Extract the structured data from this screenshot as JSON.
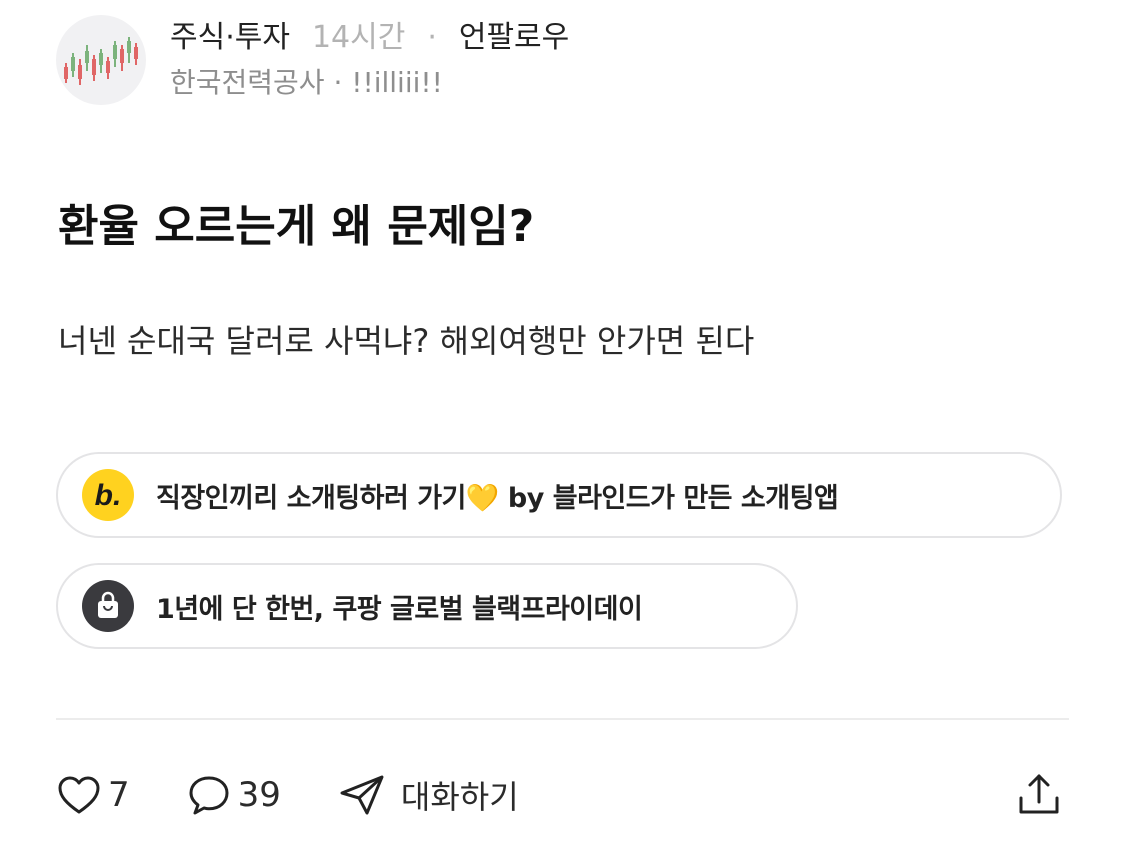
{
  "post": {
    "category": "주식·투자",
    "time": "14시간",
    "separator": "·",
    "follow_label": "언팔로우",
    "author": "한국전력공사 · !!illiii!!",
    "title": "환율 오르는게 왜 문제임?",
    "body": "너넨 순대국 달러로 사먹냐? 해외여행만 안가면 된다"
  },
  "ads": [
    {
      "text": "직장인끼리 소개팅하러 가기💛 by 블라인드가 만든 소개팅앱",
      "icon": "blind-b-logo-icon",
      "icon_letter": "b."
    },
    {
      "text": "1년에 단 한번, 쿠팡 글로벌 블랙프라이데이",
      "icon": "shopping-bag-icon"
    }
  ],
  "actions": {
    "likes": "7",
    "comments": "39",
    "message_label": "대화하기"
  },
  "colors": {
    "accent_yellow": "#ffd21f",
    "icon_dark": "#3a3a3e",
    "muted_text": "#8e8e8e",
    "time_text": "#b3b3b3"
  }
}
